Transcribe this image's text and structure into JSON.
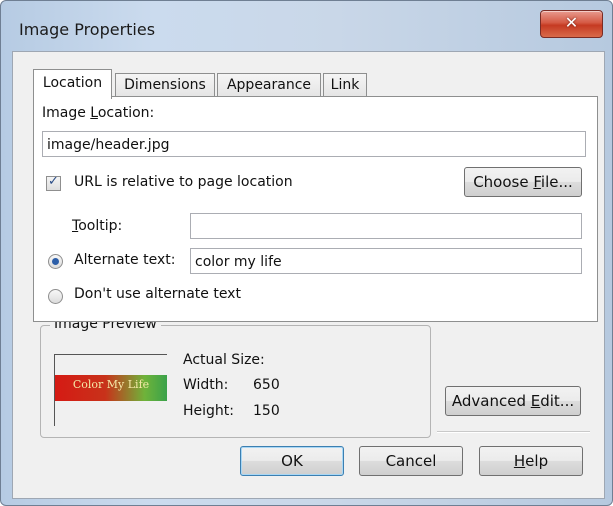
{
  "window": {
    "title": "Image Properties",
    "close_icon": "close-icon"
  },
  "tabs": [
    {
      "label": "Location",
      "active": true
    },
    {
      "label": "Dimensions",
      "active": false
    },
    {
      "label": "Appearance",
      "active": false
    },
    {
      "label": "Link",
      "active": false
    }
  ],
  "location": {
    "image_location_label_pre": "Image ",
    "image_location_label_u": "L",
    "image_location_label_post": "ocation:",
    "image_location_value": "image/header.jpg",
    "relative_checkbox_label": "URL is relative to page location",
    "relative_checked": true,
    "choose_file_pre": "Choose ",
    "choose_file_u": "F",
    "choose_file_post": "ile...",
    "tooltip_label_u": "T",
    "tooltip_label_post": "ooltip:",
    "tooltip_value": "",
    "alt_text_label": "Alternate text:",
    "alt_text_value": "color my life",
    "no_alt_label": "Don't use alternate text",
    "selected_option": "Alternate text"
  },
  "preview": {
    "group_title": "Image Preview",
    "banner_text": "Color My Life",
    "actual_size_label": "Actual Size:",
    "width_label": "Width:",
    "width_value": "650",
    "height_label": "Height:",
    "height_value": "150"
  },
  "buttons": {
    "advanced_pre": "Advanced ",
    "advanced_u": "E",
    "advanced_post": "dit...",
    "ok": "OK",
    "cancel": "Cancel",
    "help_u": "H",
    "help_post": "elp"
  }
}
